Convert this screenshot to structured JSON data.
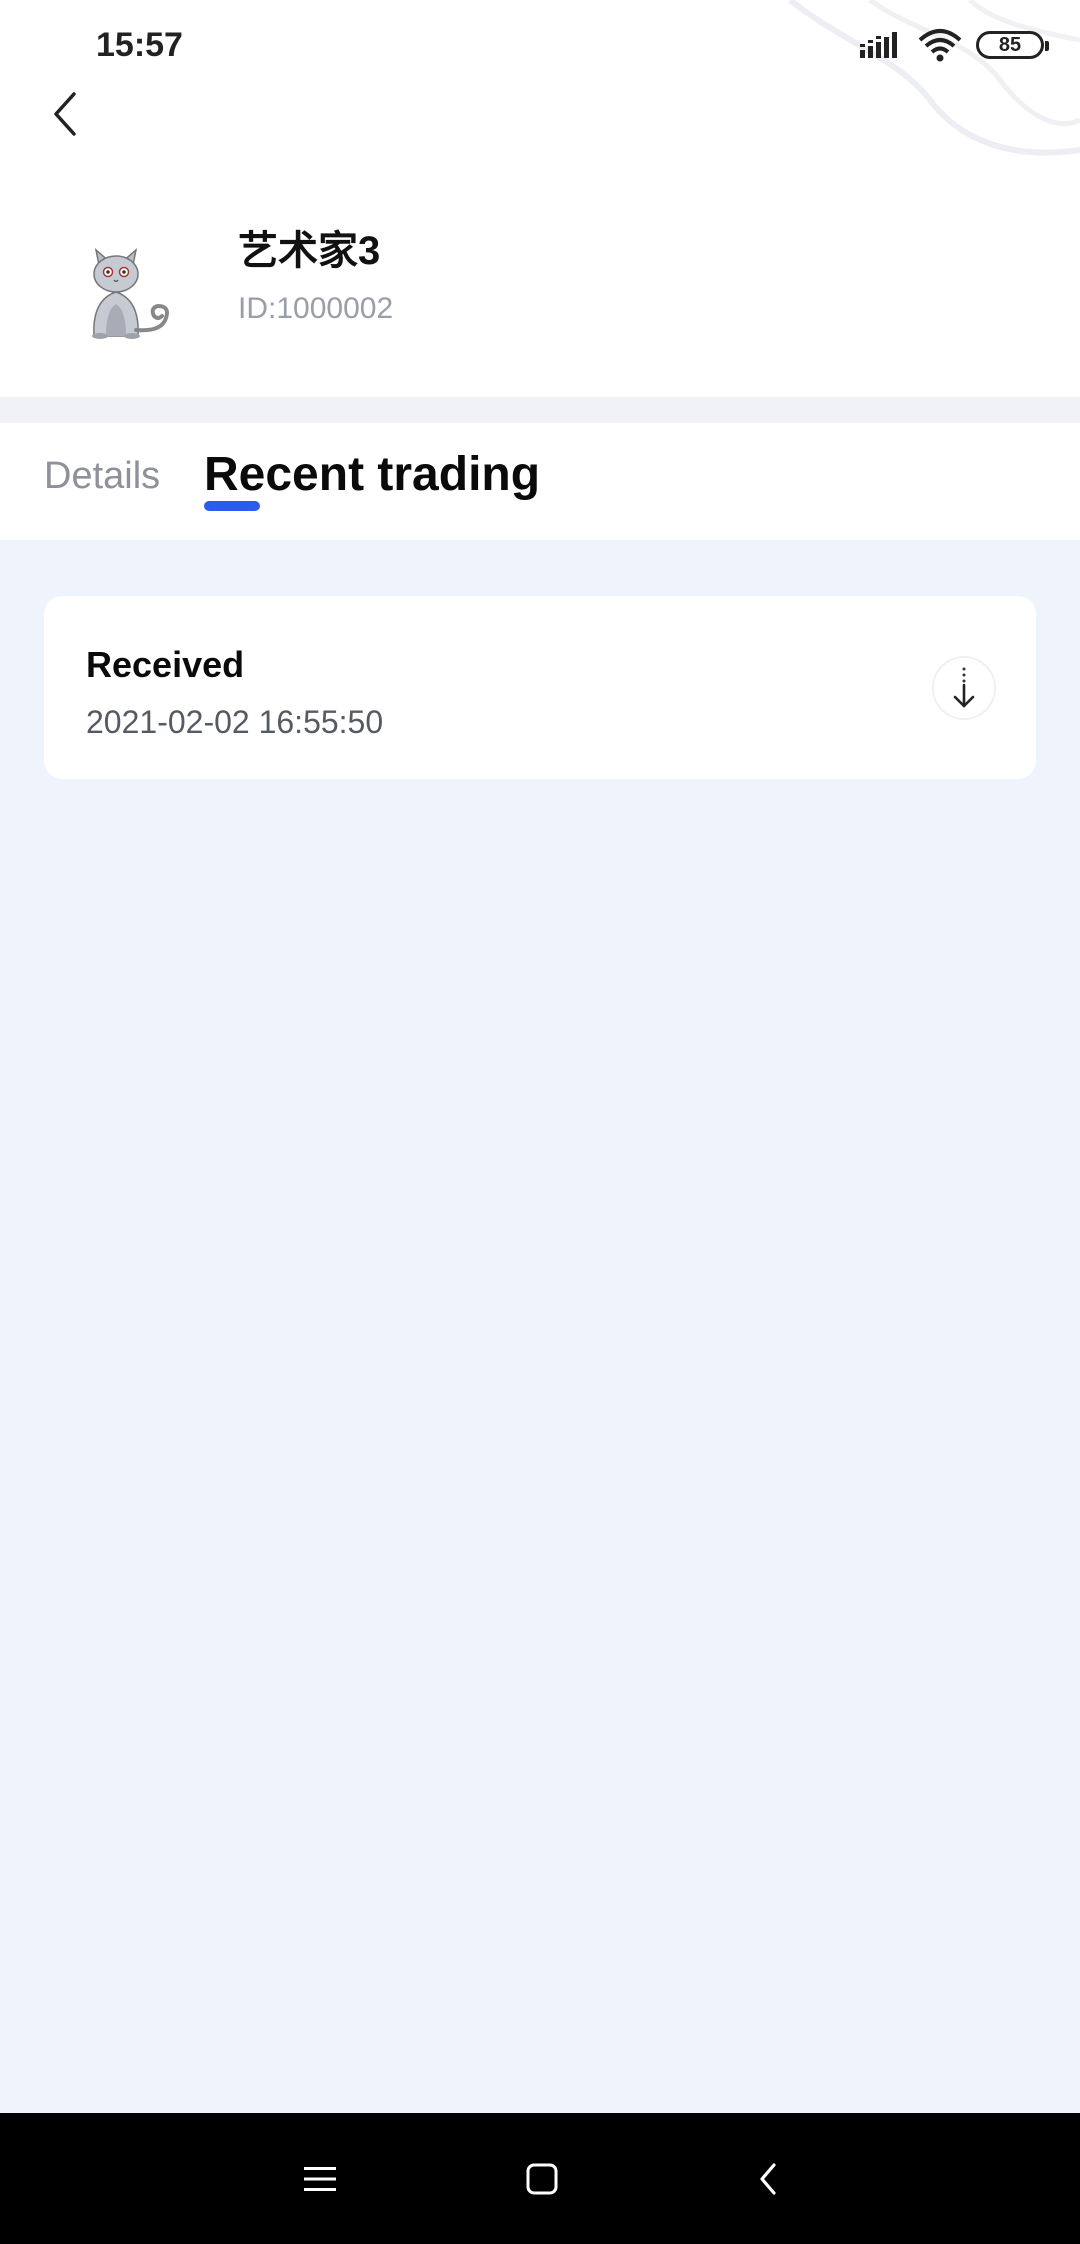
{
  "status_bar": {
    "time": "15:57",
    "battery": "85",
    "icons": [
      "signal-icon",
      "wifi-icon",
      "battery-icon"
    ]
  },
  "header": {
    "back_icon": "back-chevron-icon"
  },
  "profile": {
    "name": "艺术家3",
    "id": "ID:1000002",
    "avatar": "cat-avatar"
  },
  "tabs": [
    {
      "label": "Details",
      "active": false
    },
    {
      "label": "Recent trading",
      "active": true
    }
  ],
  "trades": [
    {
      "status": "Received",
      "timestamp": "2021-02-02 16:55:50",
      "icon": "arrow-down-icon"
    }
  ],
  "nav_bar": {
    "icons": [
      "menu-icon",
      "home-square-icon",
      "back-triangle-icon"
    ]
  },
  "colors": {
    "accent": "#2a5ee8",
    "background": "#eff3fb",
    "card": "#ffffff",
    "muted_text": "#9a9ea7"
  }
}
